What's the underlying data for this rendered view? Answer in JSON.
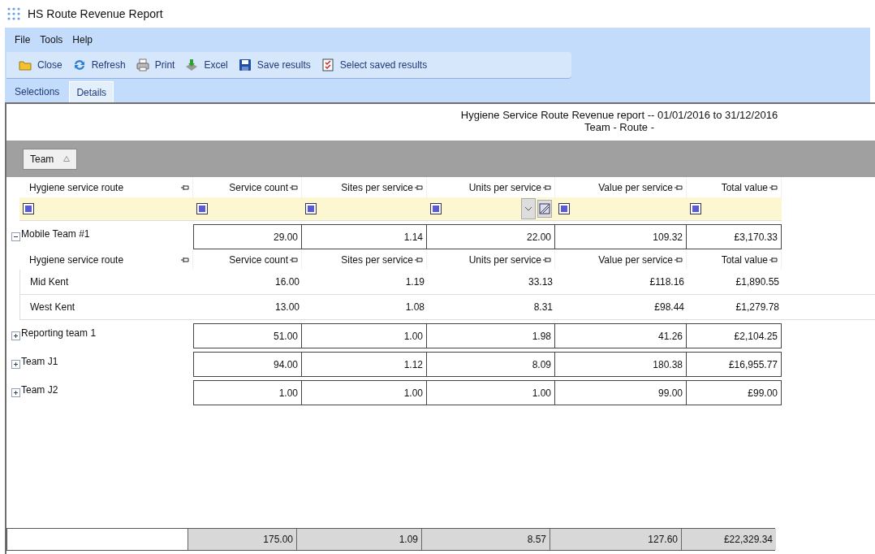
{
  "window": {
    "title": "HS Route Revenue Report"
  },
  "menu": [
    "File",
    "Tools",
    "Help"
  ],
  "toolbar": [
    {
      "kind": "folder",
      "label": "Close"
    },
    {
      "kind": "refresh",
      "label": "Refresh"
    },
    {
      "kind": "print",
      "label": "Print"
    },
    {
      "kind": "excel",
      "label": "Excel"
    },
    {
      "kind": "save",
      "label": "Save results"
    },
    {
      "kind": "checklist",
      "label": "Select saved results"
    }
  ],
  "tabs": [
    {
      "label": "Selections",
      "selected": false
    },
    {
      "label": "Details",
      "selected": true
    }
  ],
  "report": {
    "title": "Hygiene Service Route Revenue report -- 01/01/2016 to 31/12/2016",
    "subtitle": "Team -  Route -"
  },
  "group_by": [
    "Team"
  ],
  "columns": [
    "Hygiene service route",
    "Service count",
    "Sites per service",
    "Units per service",
    "Value per service",
    "Total value"
  ],
  "groups": [
    {
      "name": "Mobile Team #1",
      "expanded": true,
      "values": [
        "29.00",
        "1.14",
        "22.00",
        "109.32",
        "£3,170.33"
      ],
      "child_columns": [
        "Hygiene service route",
        "Service count",
        "Sites per service",
        "Units per service",
        "Value per service",
        "Total value"
      ],
      "children": [
        {
          "name": "Mid Kent",
          "values": [
            "16.00",
            "1.19",
            "33.13",
            "£118.16",
            "£1,890.55"
          ]
        },
        {
          "name": "West Kent",
          "values": [
            "13.00",
            "1.08",
            "8.31",
            "£98.44",
            "£1,279.78"
          ]
        }
      ]
    },
    {
      "name": "Reporting team 1",
      "expanded": false,
      "values": [
        "51.00",
        "1.00",
        "1.98",
        "41.26",
        "£2,104.25"
      ]
    },
    {
      "name": "Team J1",
      "expanded": false,
      "values": [
        "94.00",
        "1.12",
        "8.09",
        "180.38",
        "£16,955.77"
      ]
    },
    {
      "name": "Team J2",
      "expanded": false,
      "values": [
        "1.00",
        "1.00",
        "1.00",
        "99.00",
        "£99.00"
      ]
    }
  ],
  "totals": [
    "175.00",
    "1.09",
    "8.57",
    "127.60",
    "£22,329.34"
  ]
}
